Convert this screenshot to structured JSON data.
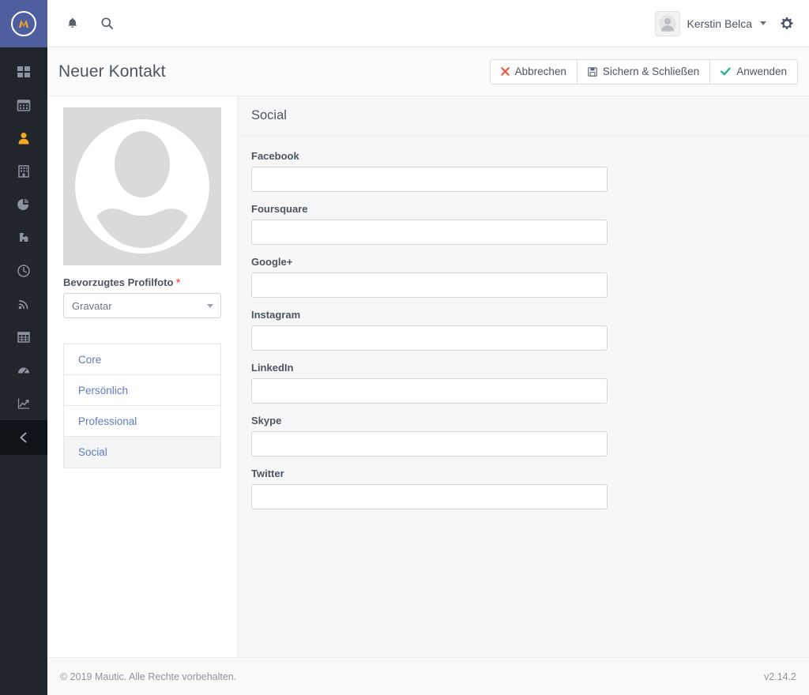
{
  "app": {
    "logo_icon": "mautic-logo-icon",
    "logo_letter": "M"
  },
  "topbar": {
    "notifications_icon": "bell-icon",
    "search_icon": "search-icon",
    "user": {
      "name": "Kerstin Belca",
      "avatar_icon": "user-avatar-icon",
      "caret_icon": "chevron-down-icon"
    },
    "settings_icon": "gear-icon"
  },
  "rail": {
    "items": [
      {
        "name": "dashboard",
        "icon": "dashboard-grid-icon",
        "active": false
      },
      {
        "name": "calendar",
        "icon": "calendar-icon",
        "active": false
      },
      {
        "name": "contacts",
        "icon": "user-icon",
        "active": true
      },
      {
        "name": "companies",
        "icon": "building-icon",
        "active": false
      },
      {
        "name": "segments",
        "icon": "pie-chart-icon",
        "active": false
      },
      {
        "name": "campaigns",
        "icon": "puzzle-piece-icon",
        "active": false
      },
      {
        "name": "points",
        "icon": "clock-icon",
        "active": false
      },
      {
        "name": "stages",
        "icon": "rss-icon",
        "active": false
      },
      {
        "name": "forms",
        "icon": "table-icon",
        "active": false
      },
      {
        "name": "reports",
        "icon": "gauge-icon",
        "active": false
      },
      {
        "name": "analytics",
        "icon": "line-chart-icon",
        "active": false
      }
    ],
    "collapse": {
      "name": "collapse-sidebar",
      "icon": "chevron-left-icon"
    }
  },
  "page": {
    "title": "Neuer Kontakt",
    "actions": [
      {
        "key": "cancel",
        "label": "Abbrechen",
        "icon": "times-icon"
      },
      {
        "key": "save",
        "label": "Sichern & Schließen",
        "icon": "floppy-disk-icon"
      },
      {
        "key": "apply",
        "label": "Anwenden",
        "icon": "check-icon"
      }
    ]
  },
  "sidepanel": {
    "avatar_icon": "contact-placeholder-avatar-icon",
    "photo_label": "Bevorzugtes Profilfoto",
    "photo_required_mark": "*",
    "photo_select": {
      "value": "Gravatar",
      "caret_icon": "caret-down-icon"
    },
    "tabs": [
      {
        "key": "core",
        "label": "Core",
        "active": false
      },
      {
        "key": "personal",
        "label": "Persönlich",
        "active": false
      },
      {
        "key": "professional",
        "label": "Professional",
        "active": false
      },
      {
        "key": "social",
        "label": "Social",
        "active": true
      }
    ]
  },
  "form": {
    "section_title": "Social",
    "fields": [
      {
        "key": "facebook",
        "label": "Facebook",
        "value": "",
        "placeholder": ""
      },
      {
        "key": "foursquare",
        "label": "Foursquare",
        "value": "",
        "placeholder": ""
      },
      {
        "key": "googleplus",
        "label": "Google+",
        "value": "",
        "placeholder": ""
      },
      {
        "key": "instagram",
        "label": "Instagram",
        "value": "",
        "placeholder": ""
      },
      {
        "key": "linkedin",
        "label": "LinkedIn",
        "value": "",
        "placeholder": ""
      },
      {
        "key": "skype",
        "label": "Skype",
        "value": "",
        "placeholder": ""
      },
      {
        "key": "twitter",
        "label": "Twitter",
        "value": "",
        "placeholder": ""
      }
    ]
  },
  "footer": {
    "copyright": "© 2019 Mautic. Alle Rechte vorbehalten.",
    "version": "v2.14.2"
  },
  "colors": {
    "brand_blue": "#4e5e9e",
    "rail_dark": "#21262d",
    "accent_orange": "#f5a623",
    "danger_red": "#f5563f",
    "success_teal": "#1bb394",
    "link_blue": "#5f7bbf"
  }
}
